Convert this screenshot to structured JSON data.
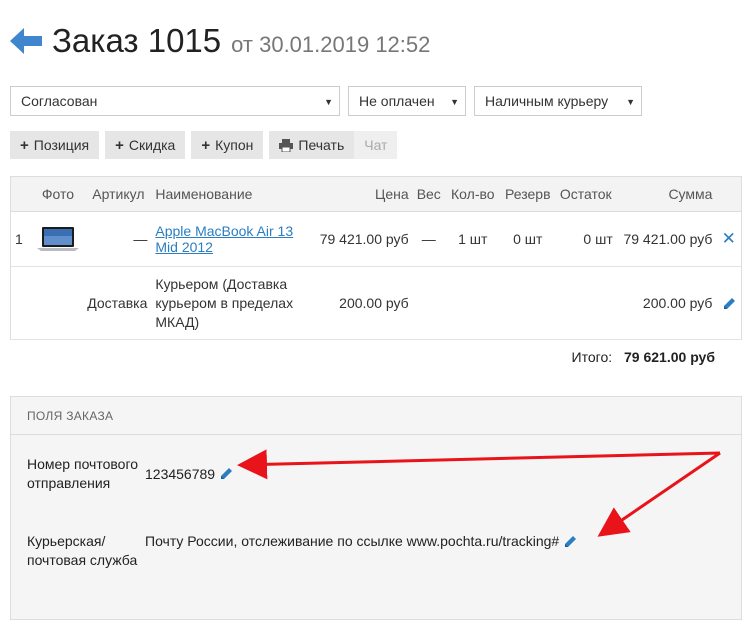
{
  "header": {
    "title": "Заказ 1015",
    "subtitle": "от 30.01.2019 12:52"
  },
  "selects": {
    "status": "Согласован",
    "payment": "Не оплачен",
    "delivery": "Наличным курьеру"
  },
  "toolbar": {
    "position": "Позиция",
    "discount": "Скидка",
    "coupon": "Купон",
    "print": "Печать",
    "chat": "Чат"
  },
  "table": {
    "headers": [
      "Фото",
      "Артикул",
      "Наименование",
      "Цена",
      "Вес",
      "Кол-во",
      "Резерв",
      "Остаток",
      "Сумма"
    ],
    "rows": [
      {
        "num": "1",
        "article": "—",
        "name": "Apple MacBook Air 13 Mid 2012",
        "price": "79 421.00 руб",
        "weight": "—",
        "qty": "1 шт",
        "reserve": "0 шт",
        "stock": "0 шт",
        "sum": "79 421.00 руб"
      },
      {
        "article": "Доставка",
        "name": "Курьером (Доставка курьером в пределах МКАД)",
        "price": "200.00 руб",
        "sum": "200.00 руб"
      }
    ]
  },
  "total": {
    "label": "Итого:",
    "value": "79 621.00 руб"
  },
  "fields": {
    "title": "ПОЛЯ ЗАКАЗА",
    "items": [
      {
        "label": "Номер почтового отправления",
        "value": "123456789"
      },
      {
        "label": "Курьерская/ почтовая служба",
        "value": "Почту России, отслеживание по ссылке www.pochta.ru/tracking#"
      }
    ]
  },
  "colors": {
    "accent": "#2a7ec1",
    "annotation": "#e8141a"
  },
  "icons": [
    "back-arrow-icon",
    "plus-icon",
    "printer-icon",
    "laptop-thumbnail",
    "delete-icon",
    "pencil-icon"
  ]
}
